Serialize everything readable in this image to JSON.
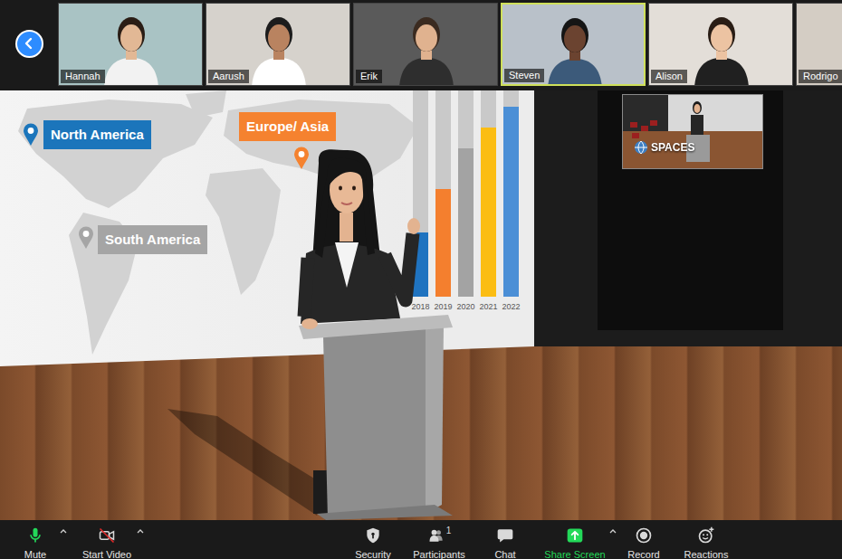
{
  "participants": [
    {
      "name": "Hannah",
      "selected": false
    },
    {
      "name": "Aarush",
      "selected": false
    },
    {
      "name": "Erik",
      "selected": false
    },
    {
      "name": "Steven",
      "selected": true
    },
    {
      "name": "Alison",
      "selected": false
    },
    {
      "name": "Rodrigo",
      "selected": false
    }
  ],
  "slide": {
    "map_labels": [
      {
        "text": "North America",
        "color": "#1b75bb"
      },
      {
        "text": "Europe/ Asia",
        "color": "#f5822f"
      },
      {
        "text": "South America",
        "color": "#a5a5a5"
      }
    ],
    "chart": {
      "categories": [
        "2018",
        "2019",
        "2020",
        "2021",
        "2022"
      ],
      "values": [
        31,
        52,
        72,
        82,
        92
      ],
      "colors": [
        "#1f73c0",
        "#f47f2e",
        "#a3a3a3",
        "#fbbd13",
        "#4b8fd6"
      ]
    }
  },
  "screen": {
    "logo": "SPACES"
  },
  "toolbar": [
    {
      "kind": "mic",
      "label": "Mute",
      "menu": true,
      "muted": false
    },
    {
      "kind": "video",
      "label": "Start Video",
      "menu": true,
      "on": false
    },
    {
      "kind": "security",
      "label": "Security",
      "menu": false
    },
    {
      "kind": "participants",
      "label": "Participants",
      "badge": "1",
      "menu": false
    },
    {
      "kind": "chat",
      "label": "Chat",
      "menu": false
    },
    {
      "kind": "share",
      "label": "Share Screen",
      "menu": true
    },
    {
      "kind": "record",
      "label": "Record",
      "menu": false
    },
    {
      "kind": "reactions",
      "label": "Reactions",
      "menu": false
    }
  ]
}
